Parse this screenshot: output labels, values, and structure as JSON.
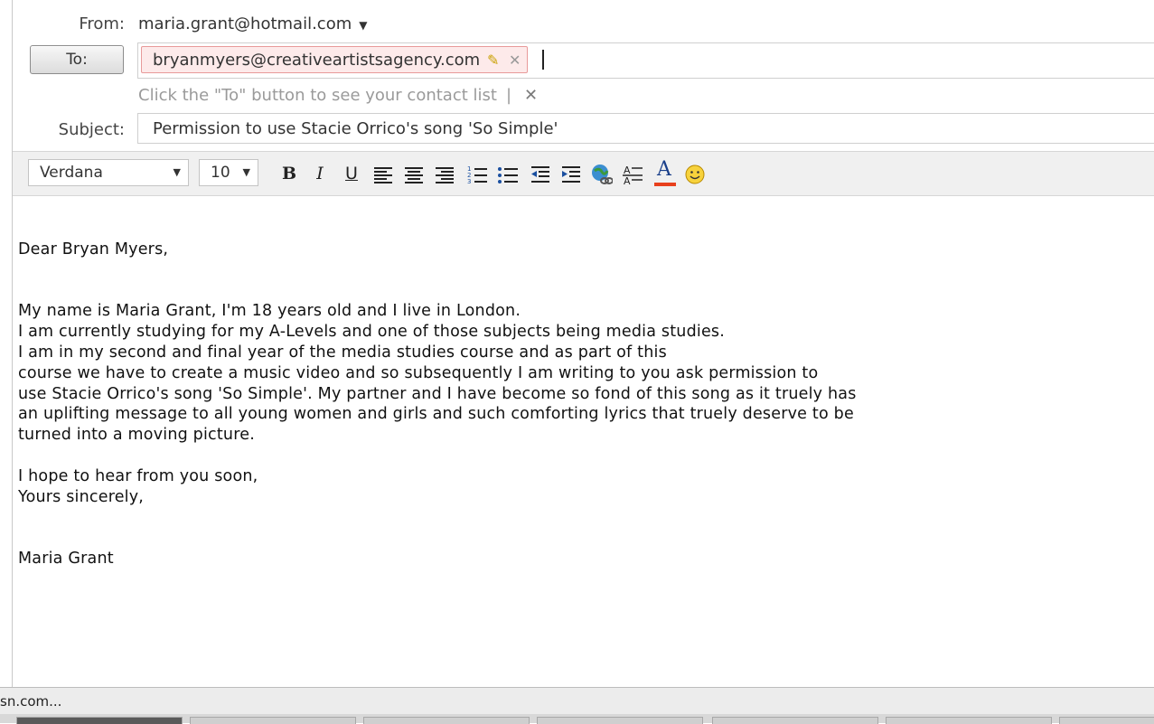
{
  "compose": {
    "from_label": "From:",
    "from_value": "maria.grant@hotmail.com",
    "to_button_label": "To:",
    "to_recipient": "bryanmyers@creativeartistsagency.com",
    "contact_hint": "Click the \"To\" button to see your contact list",
    "hint_separator": "|",
    "subject_label": "Subject:",
    "subject_value": "Permission to use Stacie Orrico's song 'So Simple'"
  },
  "toolbar": {
    "font_family_value": "Verdana",
    "font_size_value": "10",
    "bold_label": "B",
    "italic_label": "I",
    "underline_label": "U",
    "font_color_label": "A",
    "font_color": "#e8401c",
    "icons": [
      "bold-icon",
      "italic-icon",
      "underline-icon",
      "align-left-icon",
      "align-center-icon",
      "align-right-icon",
      "numbered-list-icon",
      "bulleted-list-icon",
      "decrease-indent-icon",
      "increase-indent-icon",
      "insert-link-icon",
      "highlight-icon",
      "font-color-icon",
      "emoticon-icon"
    ]
  },
  "message": {
    "greeting": "Dear Bryan Myers,",
    "paragraph1": [
      "My name is Maria Grant, I'm 18 years old and I live in London.",
      "I am currently studying for my A-Levels and one of those subjects being media studies.",
      "I am in my second and final year of the media studies course and as part of this",
      "course we have to create a music video and so subsequently I am writing to you ask permission to",
      "use Stacie Orrico's song 'So Simple'. My partner and I have become so fond of this song as it truely has",
      "an uplifting message to all young women and girls and such comforting lyrics that truely deserve to be",
      "turned into a moving picture."
    ],
    "closing1": "I hope to hear from you soon,",
    "closing2": "Yours sincerely,",
    "signature": "Maria Grant"
  },
  "status_bar": {
    "text": "sn.com..."
  },
  "colors": {
    "chip_background": "#fdeaea",
    "chip_border": "#e89a9a",
    "toolbar_background": "#f0f0f0"
  }
}
